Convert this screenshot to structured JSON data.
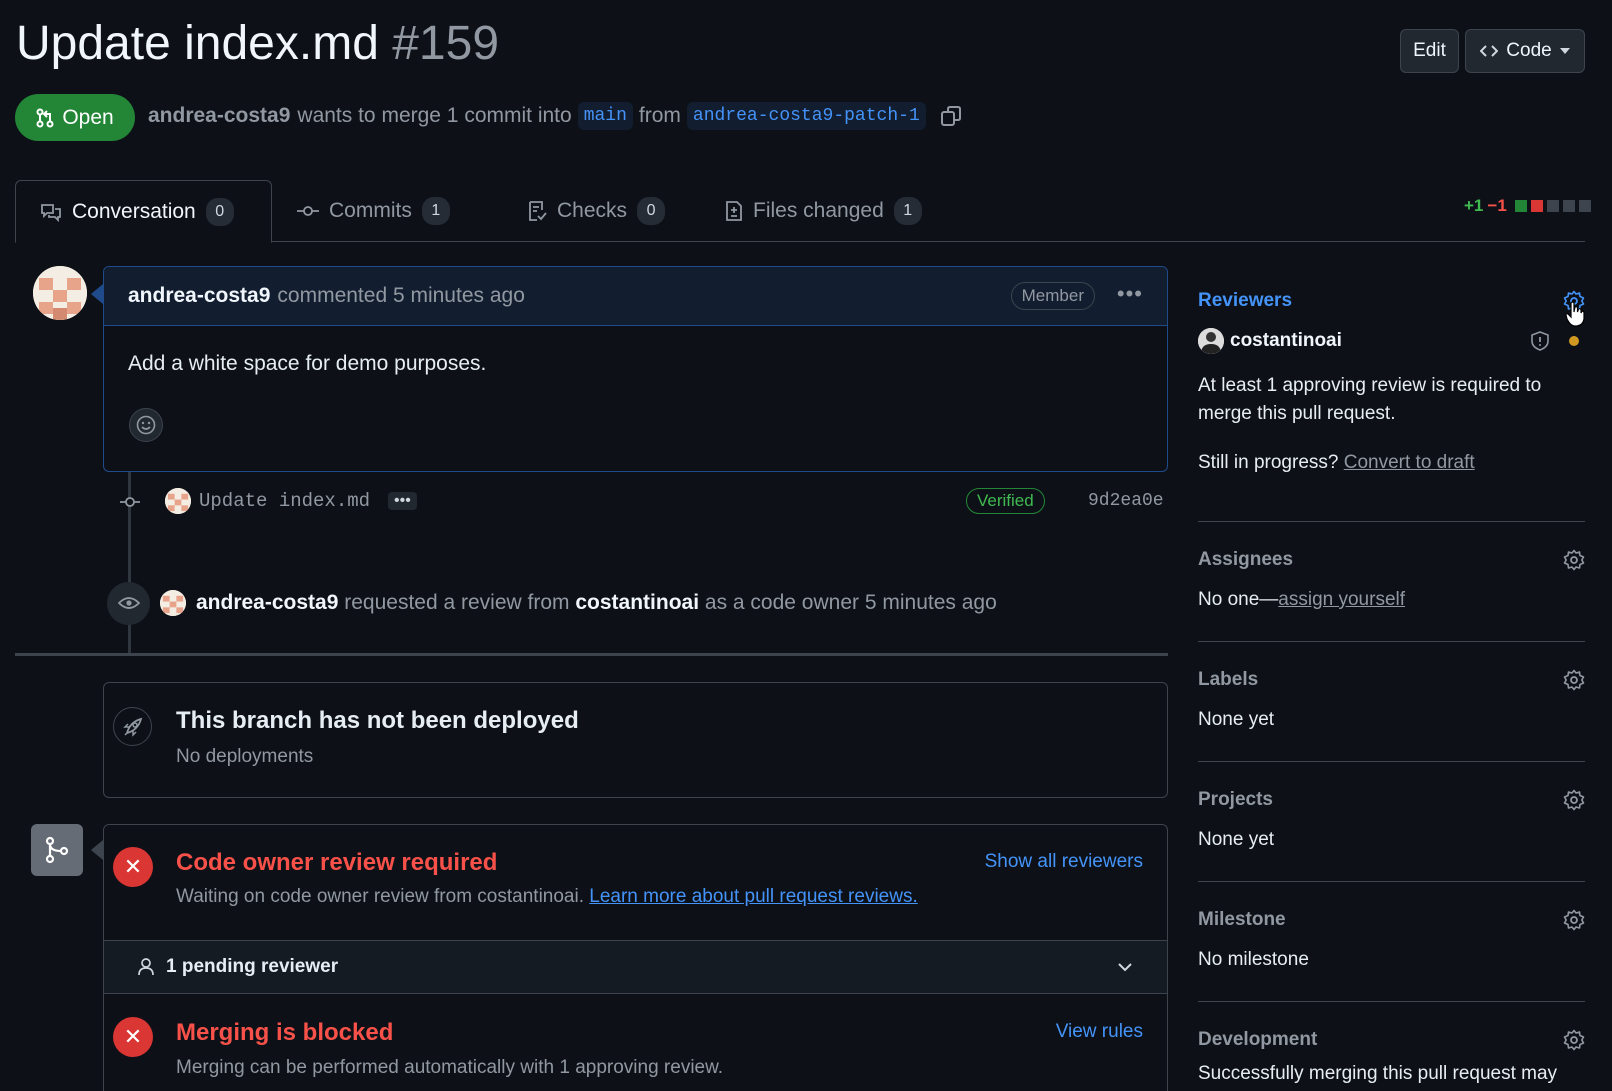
{
  "header": {
    "title": "Update index.md",
    "number": "#159",
    "edit_label": "Edit",
    "code_label": "Code"
  },
  "state": {
    "label": "Open",
    "author": "andrea-costa9",
    "merge_text": "wants to merge 1 commit into",
    "base_branch": "main",
    "from_text": "from",
    "head_branch": "andrea-costa9-patch-1"
  },
  "tabs": [
    {
      "label": "Conversation",
      "count": "0"
    },
    {
      "label": "Commits",
      "count": "1"
    },
    {
      "label": "Checks",
      "count": "0"
    },
    {
      "label": "Files changed",
      "count": "1"
    }
  ],
  "diffstat": {
    "added": "+1",
    "removed": "−1"
  },
  "comment": {
    "author": "andrea-costa9",
    "action": "commented 5 minutes ago",
    "badge": "Member",
    "body": "Add a white space for demo purposes."
  },
  "commit": {
    "message": "Update index.md",
    "verified": "Verified",
    "sha": "9d2ea0e"
  },
  "review_event": {
    "actor": "andrea-costa9",
    "text1": "requested a review from",
    "reviewer": "costantinoai",
    "text2": "as a code owner 5 minutes ago"
  },
  "deploy": {
    "title": "This branch has not been deployed",
    "subtitle": "No deployments"
  },
  "merge_status": {
    "code_owner_title": "Code owner review required",
    "code_owner_sub": "Waiting on code owner review from costantinoai.",
    "learn_more": "Learn more about pull request reviews.",
    "show_reviewers": "Show all reviewers",
    "pending": "1 pending reviewer",
    "blocked_title": "Merging is blocked",
    "blocked_sub": "Merging can be performed automatically with 1 approving review.",
    "view_rules": "View rules"
  },
  "sidebar": {
    "reviewers": {
      "title": "Reviewers",
      "name": "costantinoai",
      "note": "At least 1 approving review is required to merge this pull request.",
      "draft_prefix": "Still in progress?",
      "draft_link": "Convert to draft"
    },
    "assignees": {
      "title": "Assignees",
      "prefix": "No one—",
      "link": "assign yourself"
    },
    "labels": {
      "title": "Labels",
      "value": "None yet"
    },
    "projects": {
      "title": "Projects",
      "value": "None yet"
    },
    "milestone": {
      "title": "Milestone",
      "value": "No milestone"
    },
    "development": {
      "title": "Development",
      "value": "Successfully merging this pull request may"
    }
  },
  "colors": {
    "background": "#0d1117",
    "open_green": "#238636",
    "link_blue": "#4493f8",
    "error_red": "#f85149",
    "pending_yellow": "#d29922"
  }
}
